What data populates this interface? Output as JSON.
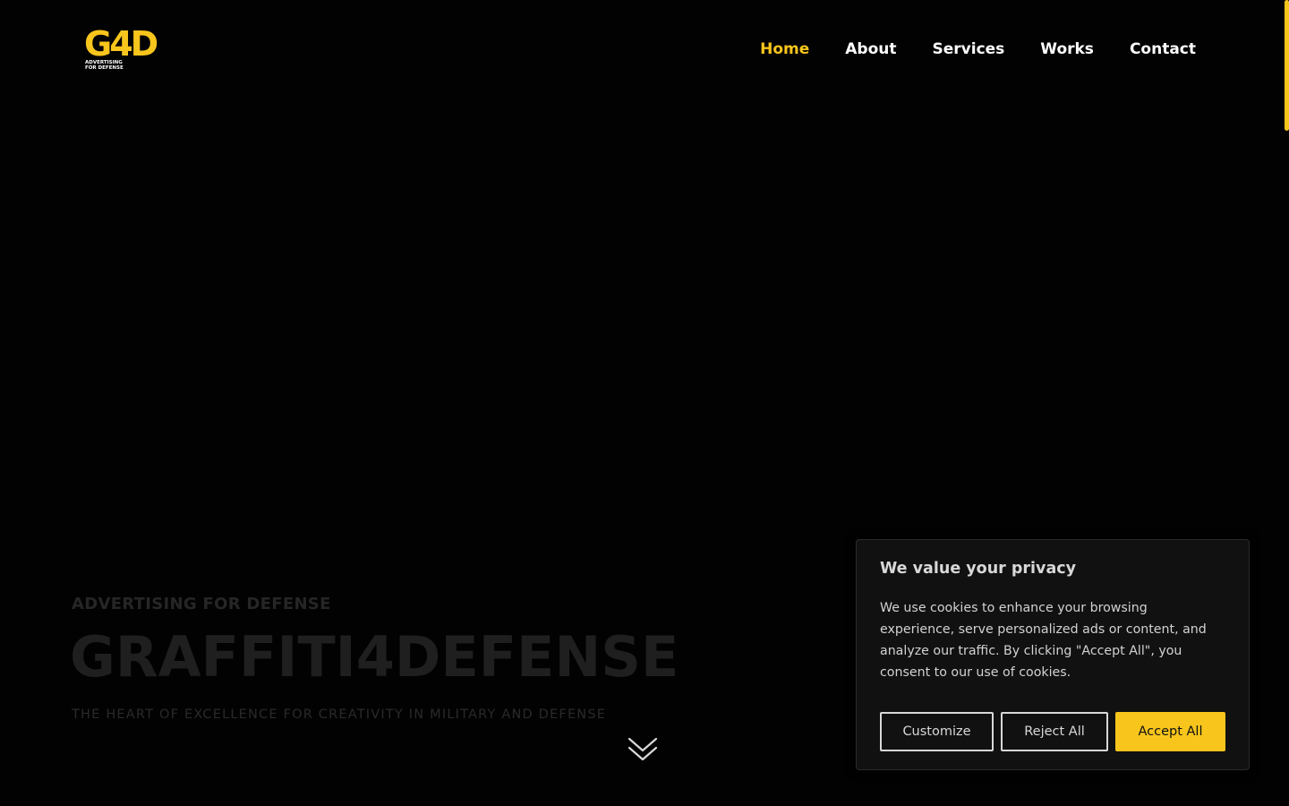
{
  "brand": {
    "logo_mark": "G4D",
    "logo_sub_line1": "ADVERTISING",
    "logo_sub_line2": "FOR DEFENSE",
    "accent_color": "#f8c51c"
  },
  "nav": {
    "items": [
      {
        "label": "Home",
        "active": true
      },
      {
        "label": "About",
        "active": false
      },
      {
        "label": "Services",
        "active": false
      },
      {
        "label": "Works",
        "active": false
      },
      {
        "label": "Contact",
        "active": false
      }
    ]
  },
  "hero": {
    "eyebrow": "ADVERTISING FOR DEFENSE",
    "title": "GRAFFITI4DEFENSE",
    "tagline": "THE HEART OF EXCELLENCE FOR CREATIVITY IN MILITARY AND DEFENSE",
    "scroll_icon": "double-chevron-down-icon"
  },
  "cookie_banner": {
    "title": "We value your privacy",
    "text": "We use cookies to enhance your browsing experience, serve personalized ads or content, and analyze our traffic. By clicking \"Accept All\", you consent to our use of cookies.",
    "customize_label": "Customize",
    "reject_label": "Reject All",
    "accept_label": "Accept All"
  }
}
